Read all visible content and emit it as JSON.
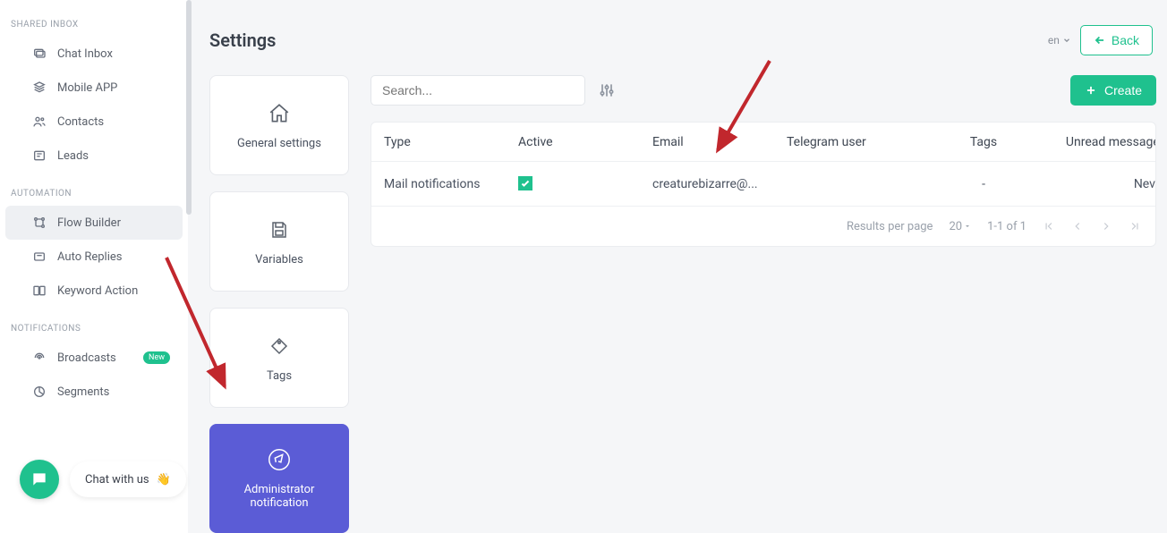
{
  "sidebar": {
    "sections": {
      "shared_inbox": {
        "title": "SHARED INBOX",
        "items": [
          {
            "label": "Chat Inbox"
          },
          {
            "label": "Mobile APP"
          },
          {
            "label": "Contacts"
          },
          {
            "label": "Leads"
          }
        ]
      },
      "automation": {
        "title": "AUTOMATION",
        "items": [
          {
            "label": "Flow Builder"
          },
          {
            "label": "Auto Replies"
          },
          {
            "label": "Keyword Action"
          }
        ]
      },
      "notifications": {
        "title": "NOTIFICATIONS",
        "items": [
          {
            "label": "Broadcasts",
            "badge": "New"
          },
          {
            "label": "Segments"
          }
        ]
      }
    }
  },
  "chat_pill": "Chat with us",
  "page_title": "Settings",
  "lang": "en",
  "back_label": "Back",
  "cards": {
    "general": "General settings",
    "variables": "Variables",
    "tags": "Tags",
    "admin_notif": "Administrator notification"
  },
  "search_placeholder": "Search...",
  "create_label": "Create",
  "table": {
    "headers": {
      "type": "Type",
      "active": "Active",
      "email": "Email",
      "telegram_user": "Telegram user",
      "tags": "Tags",
      "unread": "Unread messages"
    },
    "rows": [
      {
        "type": "Mail notifications",
        "active": true,
        "email": "creaturebizarre@...",
        "telegram_user": "",
        "tags": "-",
        "unread": "Never"
      }
    ],
    "footer": {
      "rpp_label": "Results per page",
      "rpp_value": "20",
      "range": "1-1 of 1"
    }
  }
}
